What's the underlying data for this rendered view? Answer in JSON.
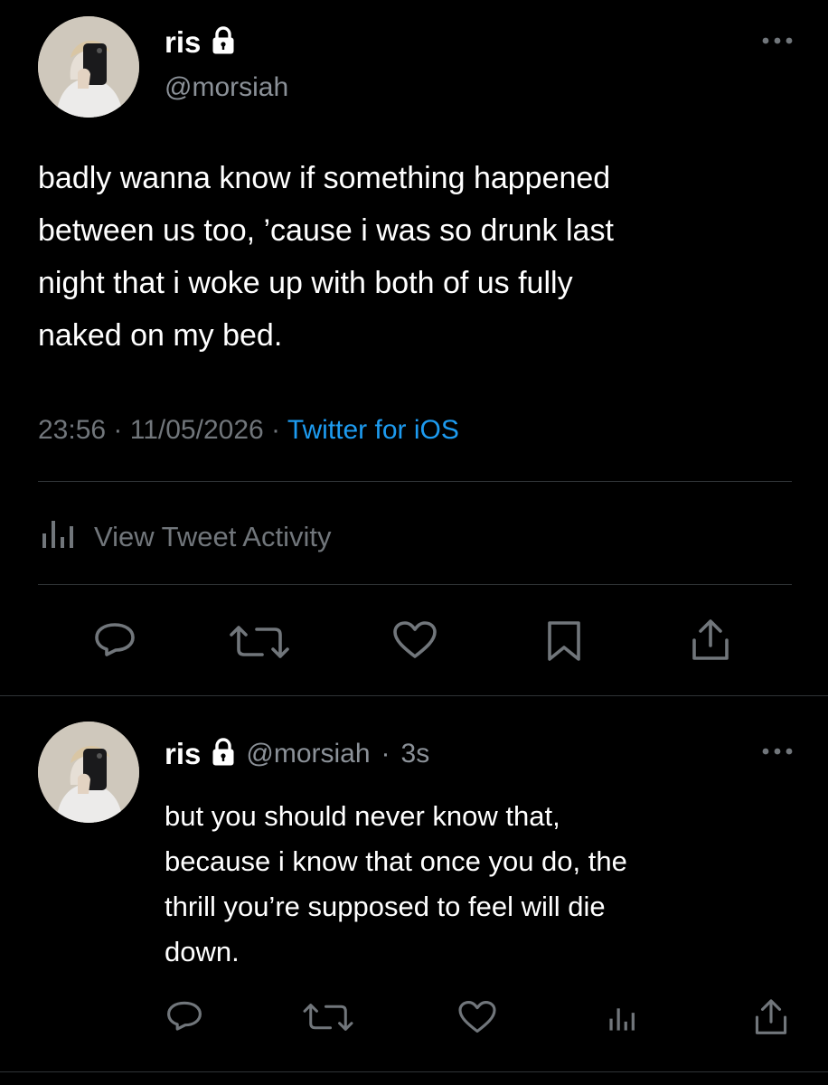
{
  "main_tweet": {
    "display_name": "ris",
    "handle": "@morsiah",
    "text": "badly wanna know if something happened\nbetween us too, ’cause i was so drunk last\nnight that i woke up with both of us fully\nnaked on my bed.",
    "time": "23:56",
    "date": "11/05/2026",
    "separator": "·",
    "source": "Twitter for iOS",
    "activity_label": "View Tweet Activity",
    "icons": {
      "lock": "lock-icon",
      "more": "more-horizontal-icon",
      "activity": "bar-chart-icon",
      "reply": "reply-bubble-icon",
      "retweet": "retweet-icon",
      "like": "heart-icon",
      "bookmark": "bookmark-icon",
      "share": "share-icon"
    }
  },
  "reply_tweet": {
    "display_name": "ris",
    "handle": "@morsiah",
    "separator": "·",
    "time_ago": "3s",
    "text": "but you should never know that,\nbecause i know that once you do, the\nthrill you’re supposed to feel will die\ndown.",
    "icons": {
      "lock": "lock-icon",
      "more": "more-horizontal-icon",
      "reply": "reply-bubble-icon",
      "retweet": "retweet-icon",
      "like": "heart-icon",
      "analytics": "bar-chart-icon",
      "share": "share-icon"
    }
  },
  "colors": {
    "background": "#000000",
    "text": "#ffffff",
    "secondary": "#71767b",
    "link": "#1d9bf0",
    "divider": "#2f3336"
  }
}
